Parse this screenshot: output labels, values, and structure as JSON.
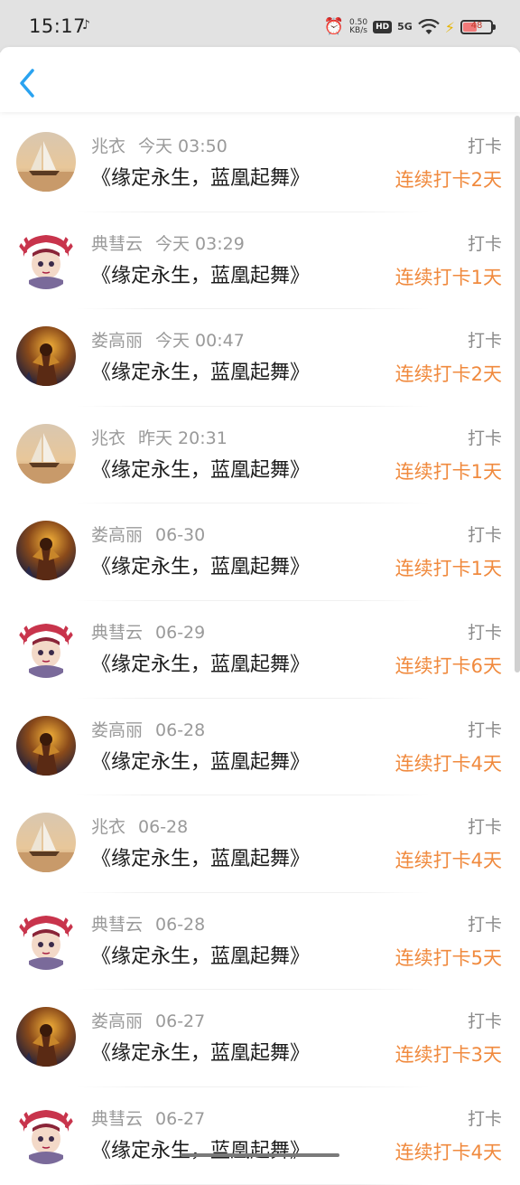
{
  "status_bar": {
    "time": "15:17",
    "speed_value": "0.50",
    "speed_unit": "KB/s",
    "hd_label": "HD",
    "network_label": "5G",
    "battery_level": "48",
    "battery_fraction": 0.48,
    "icons": [
      "music-note-icon",
      "alarm-icon",
      "hd-icon",
      "signal-5g-icon",
      "wifi-icon",
      "charging-icon",
      "battery-icon"
    ]
  },
  "nav": {
    "back_icon": "chevron-left-icon",
    "accent_color": "#2aa3f0"
  },
  "colors": {
    "name": "#9a9a9a",
    "title": "#1c1c1c",
    "type": "#8a8a8a",
    "streak": "#f08a3e"
  },
  "records": [
    {
      "user": "兆衣",
      "time": "今天 03:50",
      "title": "《缘定永生，蓝凰起舞》",
      "type": "打卡",
      "streak": "连续打卡2天",
      "avatar": "sailboat-avatar"
    },
    {
      "user": "典彗云",
      "time": "今天 03:29",
      "title": "《缘定永生，蓝凰起舞》",
      "type": "打卡",
      "streak": "连续打卡1天",
      "avatar": "cartoon-girl-avatar"
    },
    {
      "user": "娄高丽",
      "time": "今天 00:47",
      "title": "《缘定永生，蓝凰起舞》",
      "type": "打卡",
      "streak": "连续打卡2天",
      "avatar": "warrior-avatar"
    },
    {
      "user": "兆衣",
      "time": "昨天 20:31",
      "title": "《缘定永生，蓝凰起舞》",
      "type": "打卡",
      "streak": "连续打卡1天",
      "avatar": "sailboat-avatar"
    },
    {
      "user": "娄高丽",
      "time": "06-30",
      "title": "《缘定永生，蓝凰起舞》",
      "type": "打卡",
      "streak": "连续打卡1天",
      "avatar": "warrior-avatar"
    },
    {
      "user": "典彗云",
      "time": "06-29",
      "title": "《缘定永生，蓝凰起舞》",
      "type": "打卡",
      "streak": "连续打卡6天",
      "avatar": "cartoon-girl-avatar"
    },
    {
      "user": "娄高丽",
      "time": "06-28",
      "title": "《缘定永生，蓝凰起舞》",
      "type": "打卡",
      "streak": "连续打卡4天",
      "avatar": "warrior-avatar"
    },
    {
      "user": "兆衣",
      "time": "06-28",
      "title": "《缘定永生，蓝凰起舞》",
      "type": "打卡",
      "streak": "连续打卡4天",
      "avatar": "sailboat-avatar"
    },
    {
      "user": "典彗云",
      "time": "06-28",
      "title": "《缘定永生，蓝凰起舞》",
      "type": "打卡",
      "streak": "连续打卡5天",
      "avatar": "cartoon-girl-avatar"
    },
    {
      "user": "娄高丽",
      "time": "06-27",
      "title": "《缘定永生，蓝凰起舞》",
      "type": "打卡",
      "streak": "连续打卡3天",
      "avatar": "warrior-avatar"
    },
    {
      "user": "典彗云",
      "time": "06-27",
      "title": "《缘定永生，蓝凰起舞》",
      "type": "打卡",
      "streak": "连续打卡4天",
      "avatar": "cartoon-girl-avatar"
    }
  ]
}
